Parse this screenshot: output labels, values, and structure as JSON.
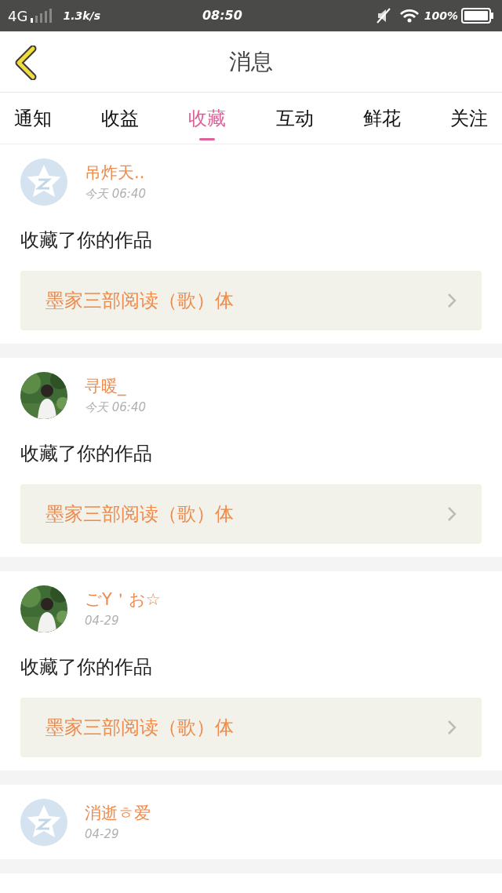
{
  "status_bar": {
    "network": "4G",
    "speed": "1.3k/s",
    "time": "08:50",
    "battery": "100%"
  },
  "header": {
    "title": "消息"
  },
  "tabs": [
    {
      "label": "通知",
      "selected": false
    },
    {
      "label": "收益",
      "selected": false
    },
    {
      "label": "收藏",
      "selected": true
    },
    {
      "label": "互动",
      "selected": false
    },
    {
      "label": "鲜花",
      "selected": false
    },
    {
      "label": "关注",
      "selected": false
    }
  ],
  "messages": [
    {
      "kind": "icon",
      "name": "吊炸天..",
      "time": "今天 06:40",
      "action": "收藏了你的作品",
      "work": "墨家三部阅读（歌）体"
    },
    {
      "kind": "picture",
      "name": "寻暖_",
      "time": "今天 06:40",
      "action": "收藏了你的作品",
      "work": "墨家三部阅读（歌）体"
    },
    {
      "kind": "picture",
      "name": "ごY＇お☆",
      "time": "04-29",
      "action": "收藏了你的作品",
      "work": "墨家三部阅读（歌）体"
    },
    {
      "kind": "icon",
      "name": "消逝ㅎ爱",
      "time": "04-29"
    }
  ]
}
